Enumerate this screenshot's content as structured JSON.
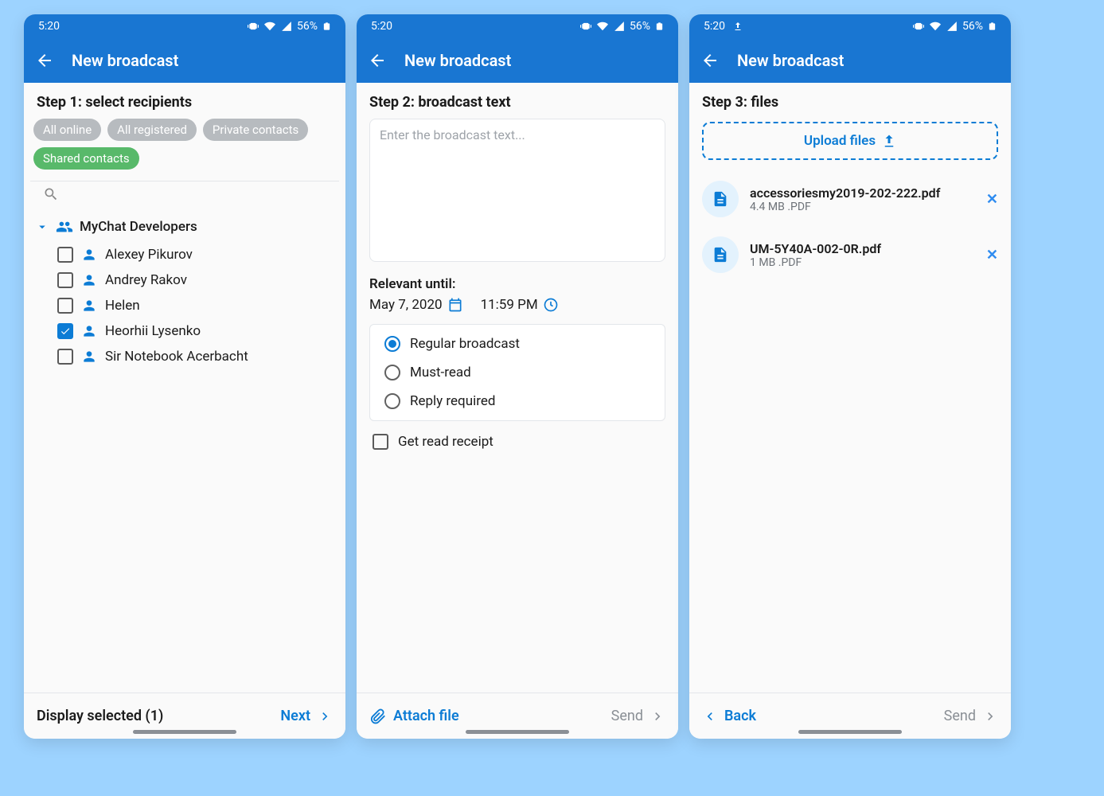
{
  "status": {
    "time": "5:20",
    "battery": "56%"
  },
  "appbar": {
    "title": "New broadcast"
  },
  "step1": {
    "title": "Step 1: select recipients",
    "chips": [
      {
        "label": "All online",
        "active": false
      },
      {
        "label": "All registered",
        "active": false
      },
      {
        "label": "Private contacts",
        "active": false
      },
      {
        "label": "Shared contacts",
        "active": true
      }
    ],
    "group": "MyChat Developers",
    "people": [
      {
        "name": "Alexey Pikurov",
        "checked": false
      },
      {
        "name": "Andrey Rakov",
        "checked": false
      },
      {
        "name": "Helen",
        "checked": false
      },
      {
        "name": "Heorhii Lysenko",
        "checked": true
      },
      {
        "name": "Sir Notebook Acerbacht",
        "checked": false
      }
    ],
    "footer": {
      "left": "Display selected  (1)",
      "right": "Next"
    }
  },
  "step2": {
    "title": "Step 2: broadcast text",
    "placeholder": "Enter the broadcast text...",
    "relevantLabel": "Relevant until:",
    "relevantDate": "May 7, 2020",
    "relevantTime": "11:59 PM",
    "options": [
      {
        "label": "Regular broadcast",
        "selected": true
      },
      {
        "label": "Must-read",
        "selected": false
      },
      {
        "label": "Reply required",
        "selected": false
      }
    ],
    "readReceipt": {
      "label": "Get read receipt",
      "checked": false
    },
    "footer": {
      "left": "Attach file",
      "right": "Send"
    }
  },
  "step3": {
    "title": "Step 3: files",
    "upload": "Upload files",
    "files": [
      {
        "name": "accessoriesmy2019-202-222.pdf",
        "meta": "4.4 MB .PDF"
      },
      {
        "name": "UM-5Y40A-002-0R.pdf",
        "meta": "1 MB .PDF"
      }
    ],
    "footer": {
      "left": "Back",
      "right": "Send"
    }
  }
}
